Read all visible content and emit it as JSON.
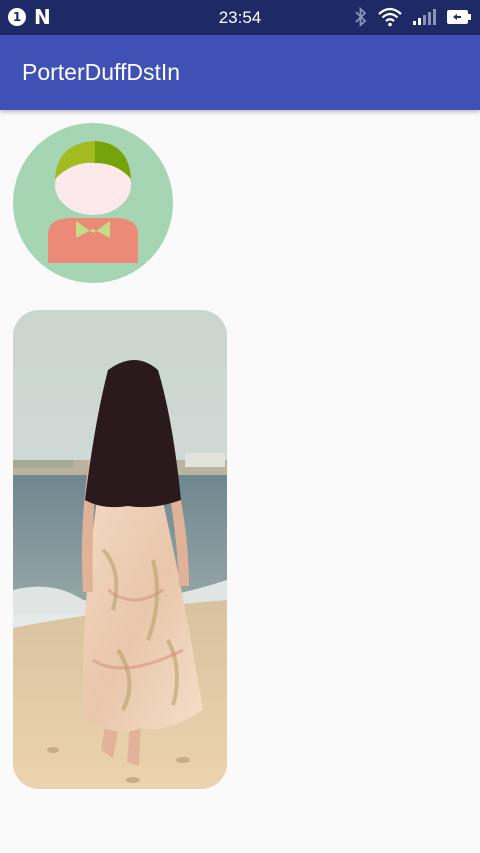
{
  "status_bar": {
    "notification_count": "1",
    "time": "23:54",
    "icons": [
      "notification-badge-icon",
      "n-logo-icon",
      "bluetooth-icon",
      "wifi-icon",
      "cell-signal-icon",
      "battery-icon"
    ]
  },
  "app_bar": {
    "title": "PorterDuffDstIn"
  },
  "colors": {
    "status_bar": "#1e2a66",
    "app_bar": "#3f51b5",
    "background": "#fafafa",
    "avatar_bg": "#a6d5b3"
  },
  "content": {
    "images": [
      "avatar-illustration",
      "beach-photo"
    ]
  }
}
